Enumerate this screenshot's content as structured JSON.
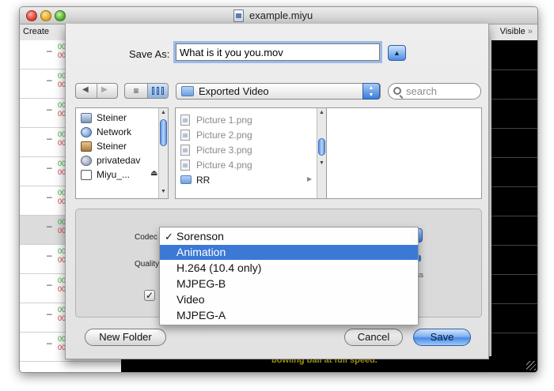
{
  "window": {
    "title": "example.miyu",
    "toolbar_left": "Create",
    "toolbar_right": "Visible",
    "toolbar_right_icon": "double-chevron-icon",
    "caption": "bowling ball at full speed."
  },
  "save_sheet": {
    "save_as_label": "Save As:",
    "filename": "What is it you you.mov",
    "location": "Exported Video",
    "search_placeholder": "search",
    "sidebar": {
      "items": [
        {
          "label": "Steiner",
          "icon": "computer-icon"
        },
        {
          "label": "Network",
          "icon": "network-icon"
        },
        {
          "label": "Steiner",
          "icon": "home-icon"
        },
        {
          "label": "privatedav",
          "icon": "shared-server-icon"
        },
        {
          "label": "Miyu_...",
          "icon": "disk-icon"
        }
      ]
    },
    "files": [
      {
        "label": "Picture 1.png",
        "kind": "file"
      },
      {
        "label": "Picture 2.png",
        "kind": "file"
      },
      {
        "label": "Picture 3.png",
        "kind": "file"
      },
      {
        "label": "Picture 4.png",
        "kind": "file"
      },
      {
        "label": "RR",
        "kind": "folder"
      }
    ],
    "options": {
      "codec_label": "Codec",
      "quality_label": "Quality",
      "slider_right_label": "ss",
      "checkbox_checked": true
    },
    "buttons": {
      "new_folder": "New Folder",
      "cancel": "Cancel",
      "save": "Save"
    }
  },
  "codec_menu": {
    "selected": "Sorenson",
    "highlighted": "Animation",
    "items": [
      "Sorenson",
      "Animation",
      "H.264 (10.4 only)",
      "MJPEG-B",
      "Video",
      "MJPEG-A"
    ],
    "check_glyph": "✓"
  },
  "colors": {
    "accent": "#3c79d6",
    "caption_text": "#e6d21e"
  }
}
